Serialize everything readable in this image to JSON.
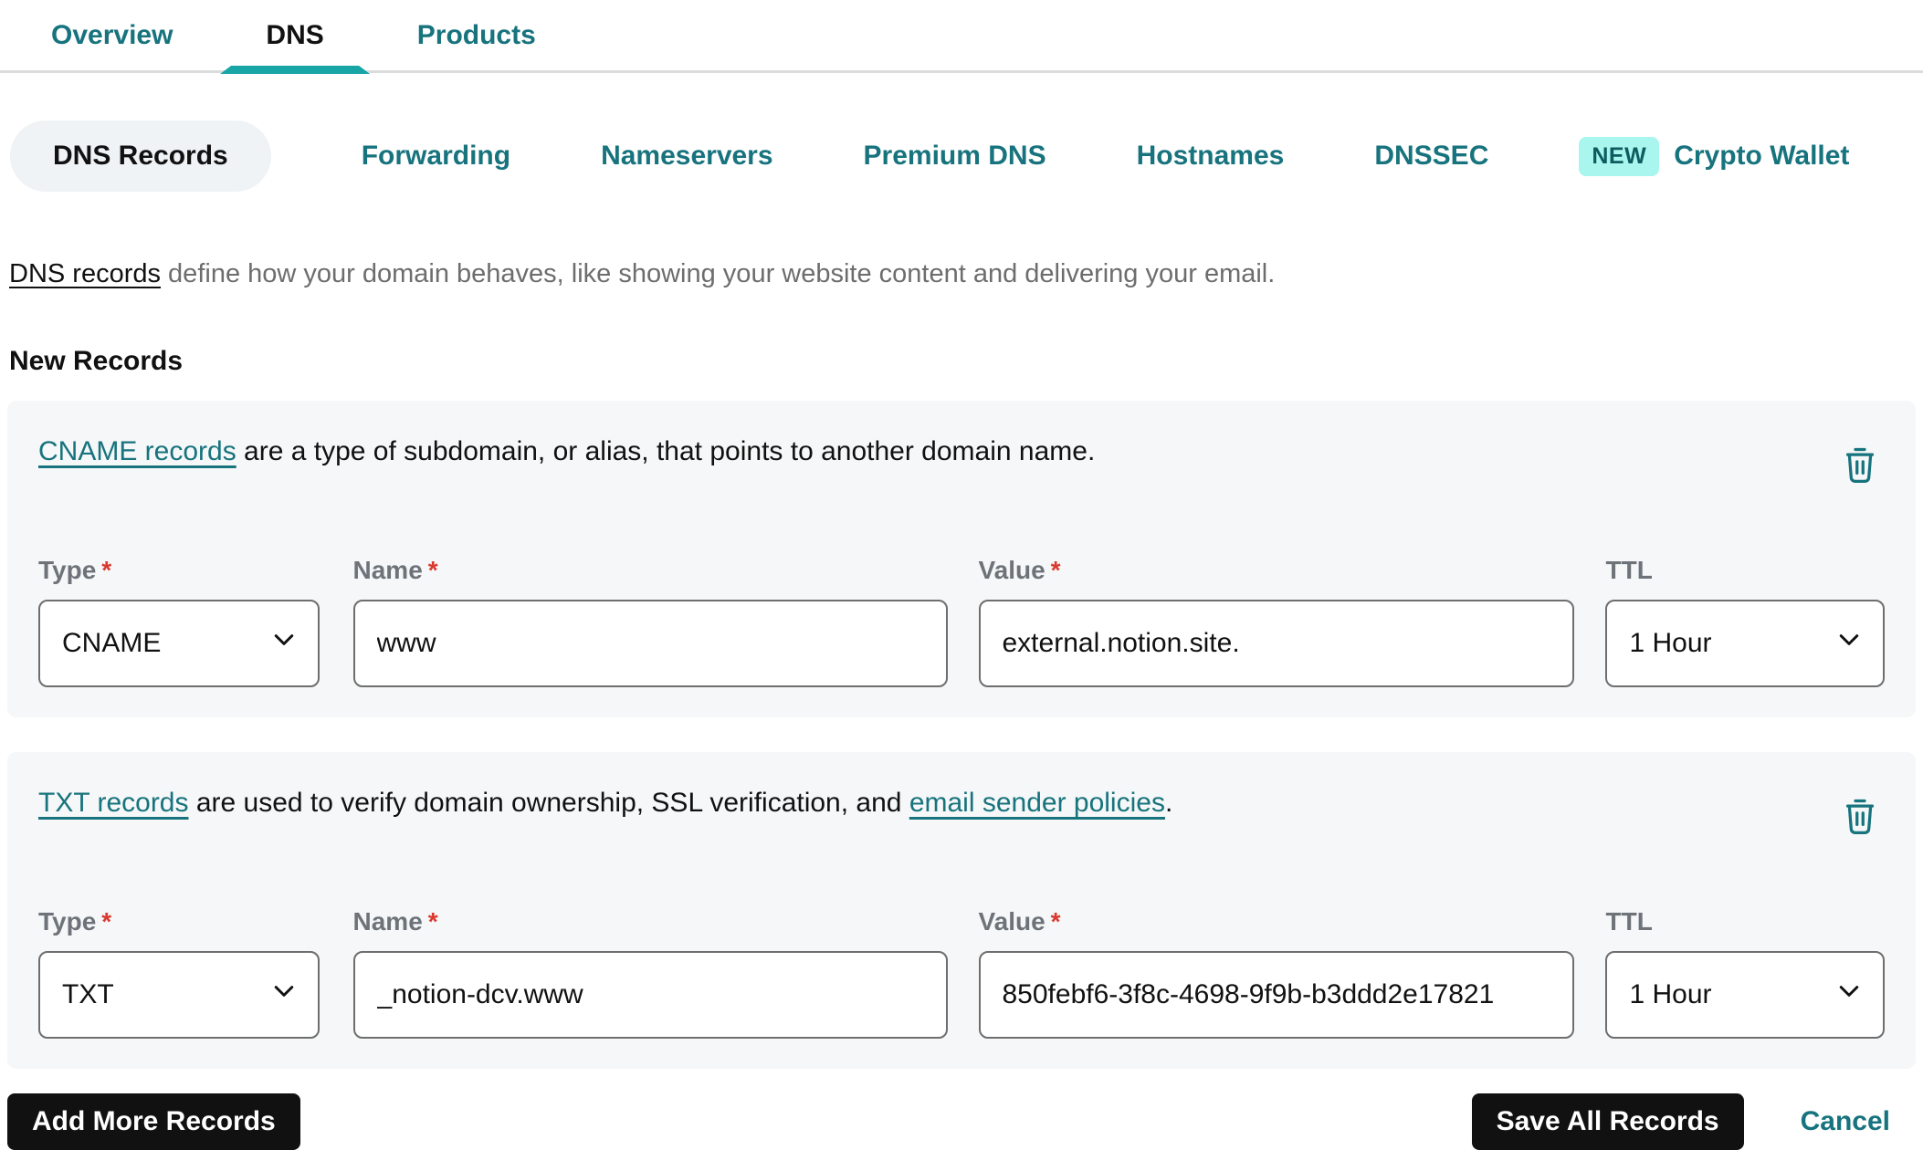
{
  "header_tabs": {
    "items": [
      {
        "label": "Overview",
        "active": false
      },
      {
        "label": "DNS",
        "active": true
      },
      {
        "label": "Products",
        "active": false
      }
    ]
  },
  "subnav": {
    "items": [
      {
        "label": "DNS Records",
        "active": true
      },
      {
        "label": "Forwarding",
        "active": false
      },
      {
        "label": "Nameservers",
        "active": false
      },
      {
        "label": "Premium DNS",
        "active": false
      },
      {
        "label": "Hostnames",
        "active": false
      },
      {
        "label": "DNSSEC",
        "active": false
      },
      {
        "label": "Crypto Wallet",
        "active": false,
        "badge": "NEW"
      }
    ]
  },
  "intro": {
    "link_text": "DNS records",
    "text": " define how your domain behaves, like showing your website content and delivering your email."
  },
  "section_title": "New Records",
  "field_labels": {
    "type": "Type",
    "name": "Name",
    "value": "Value",
    "ttl": "TTL",
    "required_marker": "*"
  },
  "records": [
    {
      "intro_link": "CNAME records",
      "intro_text": " are a type of subdomain, or alias, that points to another domain name.",
      "intro_link2": "",
      "intro_suffix": "",
      "type": "CNAME",
      "name": "www",
      "value": "external.notion.site.",
      "ttl": "1 Hour"
    },
    {
      "intro_link": "TXT records",
      "intro_text": " are used to verify domain ownership, SSL verification, and ",
      "intro_link2": "email sender policies",
      "intro_suffix": ".",
      "type": "TXT",
      "name": "_notion-dcv.www",
      "value": "850febf6-3f8c-4698-9f9b-b3ddd2e17821",
      "ttl": "1 Hour"
    }
  ],
  "footer": {
    "add_button": "Add More Records",
    "save_button": "Save All Records",
    "cancel_link": "Cancel"
  },
  "colors": {
    "teal_text": "#17737d",
    "teal_accent": "#17a5a5",
    "badge_bg": "#a9f6ee",
    "badge_text": "#0d5c5f",
    "card_bg": "#f5f7f8",
    "pill_bg": "#eff3f6",
    "button_bg": "#111111",
    "required_red": "#d9392e",
    "label_gray": "#6e737a",
    "muted_gray": "#6d6d6d",
    "input_border": "#6e6e6e",
    "ink": "#111111"
  }
}
